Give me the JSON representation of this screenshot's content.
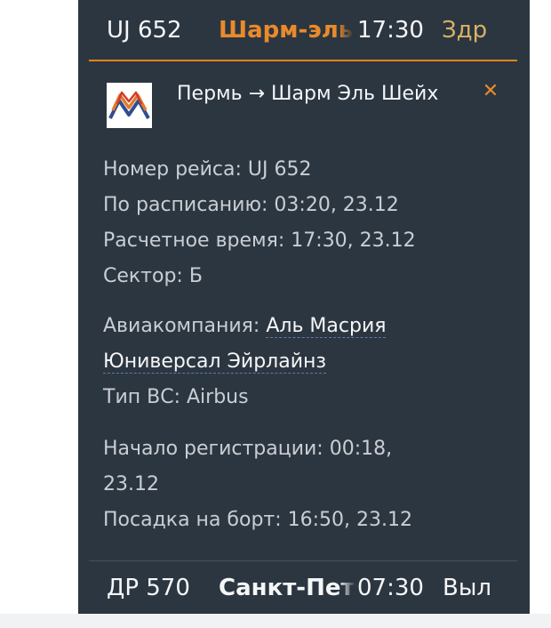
{
  "top_row": {
    "flight": "UJ 652",
    "destination": "Шарм-эль-Шейх",
    "time": "17:30",
    "status": "Здр",
    "destination_color": "#e98a2b",
    "status_color": "#d9b163"
  },
  "detail": {
    "route": "Пермь → Шарм Эль Шейх",
    "close_icon": "close-icon",
    "logo_icon": "airline-logo",
    "flight_number_label": "Номер рейса:",
    "flight_number": "UJ 652",
    "scheduled_label": "По расписанию:",
    "scheduled": "03:20, 23.12",
    "estimated_label": "Расчетное время:",
    "estimated": "17:30, 23.12",
    "sector_label": "Сектор:",
    "sector": "Б",
    "airline_label": "Авиакомпания:",
    "airline_part1": "Аль Масрия",
    "airline_part2": "Юниверсал Эйрлайнз",
    "aircraft_label": "Тип ВС:",
    "aircraft": "Airbus",
    "checkin_label": "Начало регистрации:",
    "checkin_time": "00:18,",
    "checkin_date": "23.12",
    "boarding_label": "Посадка на борт:",
    "boarding": "16:50, 23.12"
  },
  "bottom_row": {
    "flight": "ДР 570",
    "destination": "Санкт-Петербург",
    "time": "07:30",
    "status": "Выл"
  },
  "colors": {
    "panel_bg": "#2c3641",
    "accent": "#e98a2b"
  }
}
